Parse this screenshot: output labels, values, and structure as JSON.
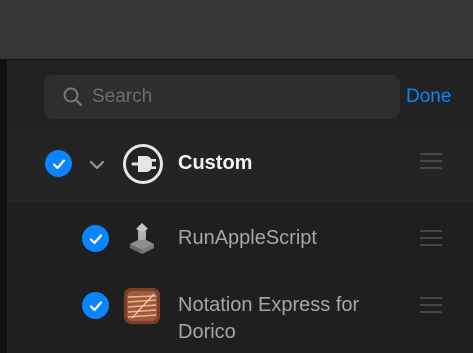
{
  "search": {
    "placeholder": "Search",
    "done_label": "Done"
  },
  "group": {
    "label": "Custom",
    "checked": true,
    "expanded": true,
    "icon": "plug-in-circle-icon"
  },
  "items": [
    {
      "label": "RunAppleScript",
      "checked": true,
      "icon": "applescript-icon"
    },
    {
      "label": "Notation Express for Dorico",
      "checked": true,
      "icon": "notation-express-icon"
    }
  ],
  "colors": {
    "accent": "#0a84ff",
    "background": "#1f1f1f",
    "titlebar": "#363636"
  }
}
